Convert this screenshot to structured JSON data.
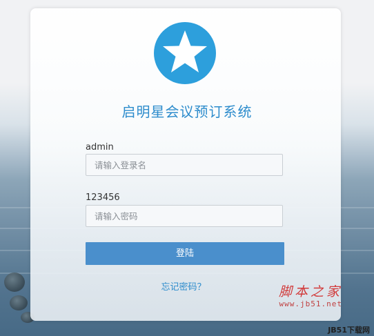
{
  "app": {
    "title": "启明星会议预订系统"
  },
  "login_form": {
    "username_label": "admin",
    "username_placeholder": "请输入登录名",
    "password_label": "123456",
    "password_placeholder": "请输入密码",
    "login_button": "登陆",
    "forgot_link": "忘记密码？"
  },
  "logo": {
    "icon": "star-icon",
    "color": "#2d9fdc"
  },
  "watermark": {
    "main": "脚本之家",
    "url": "www.jb51.net",
    "corner": "JB51下载网"
  },
  "colors": {
    "accent": "#2d8ccc",
    "button": "#4a8fcc",
    "watermark": "#d23b3b"
  }
}
